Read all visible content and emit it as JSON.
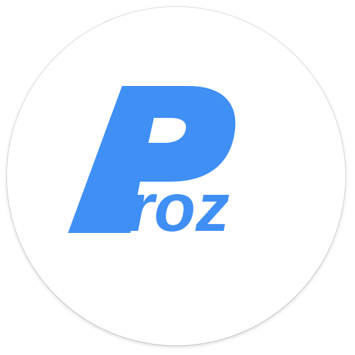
{
  "app_icon": {
    "logo_text": "Proz",
    "brand_color": "#3f8ff5",
    "background_color": "#ffffff"
  }
}
